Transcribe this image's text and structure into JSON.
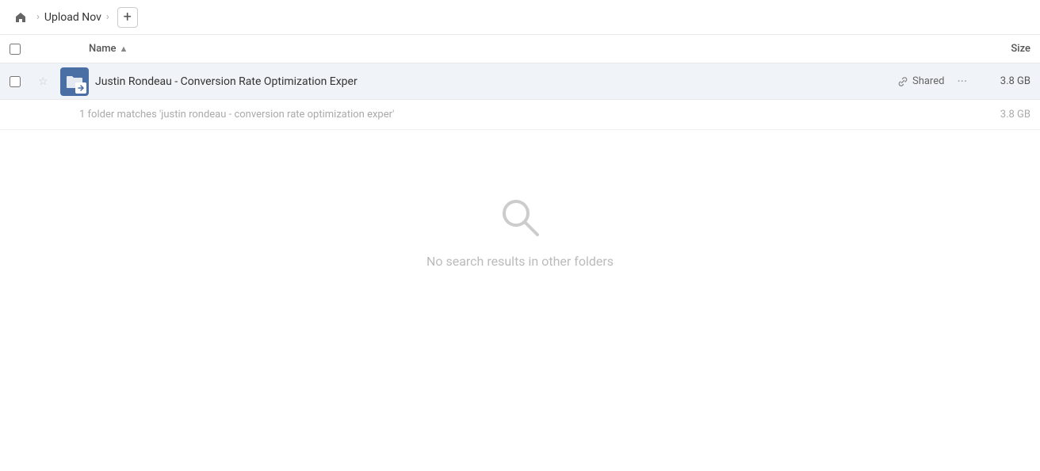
{
  "breadcrumb": {
    "home_label": "🏠",
    "sep1": "›",
    "folder_label": "Upload Nov",
    "sep2": "›",
    "add_label": "+"
  },
  "table_header": {
    "name_label": "Name",
    "sort_indicator": "▲",
    "size_label": "Size"
  },
  "file_row": {
    "name": "Justin Rondeau - Conversion Rate Optimization Exper",
    "shared_label": "Shared",
    "size": "3.8 GB"
  },
  "match_summary": {
    "text": "1 folder matches 'justin rondeau - conversion rate optimization exper'",
    "size": "3.8 GB"
  },
  "no_results": {
    "text": "No search results in other folders"
  },
  "icons": {
    "home": "⌂",
    "link": "🔗",
    "more": "···",
    "star": "☆"
  }
}
